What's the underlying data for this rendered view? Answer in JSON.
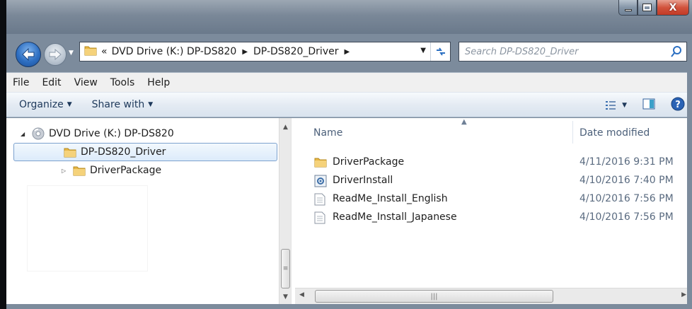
{
  "window": {
    "caption": {
      "minimize": "–",
      "maximize": "□",
      "close": "X"
    }
  },
  "nav": {
    "back_icon": "back-arrow-icon",
    "forward_icon": "forward-arrow-icon",
    "address": {
      "prefix": "«",
      "crumbs": [
        "DVD Drive (K:) DP-DS820",
        "DP-DS820_Driver"
      ]
    },
    "search_placeholder": "Search DP-DS820_Driver"
  },
  "menubar": [
    "File",
    "Edit",
    "View",
    "Tools",
    "Help"
  ],
  "commandbar": {
    "organize": "Organize",
    "share_with": "Share with"
  },
  "tree": [
    {
      "label": "DVD Drive (K:) DP-DS820",
      "icon": "dvd-drive-icon",
      "expanded": true
    },
    {
      "label": "DP-DS820_Driver",
      "icon": "folder-icon",
      "expanded": true,
      "selected": true
    },
    {
      "label": "DriverPackage",
      "icon": "folder-icon",
      "expanded": false
    }
  ],
  "columns": {
    "name": "Name",
    "date": "Date modified"
  },
  "files": [
    {
      "name": "DriverPackage",
      "date": "4/11/2016 9:31 PM",
      "icon": "folder-icon"
    },
    {
      "name": "DriverInstall",
      "date": "4/10/2016 7:40 PM",
      "icon": "setup-icon"
    },
    {
      "name": "ReadMe_Install_English",
      "date": "4/10/2016 7:56 PM",
      "icon": "text-file-icon"
    },
    {
      "name": "ReadMe_Install_Japanese",
      "date": "4/10/2016 7:56 PM",
      "icon": "text-file-icon"
    }
  ],
  "colors": {
    "frame": "#7c8b9c",
    "selection": "#dcebfb",
    "command_text": "#1e395b"
  }
}
